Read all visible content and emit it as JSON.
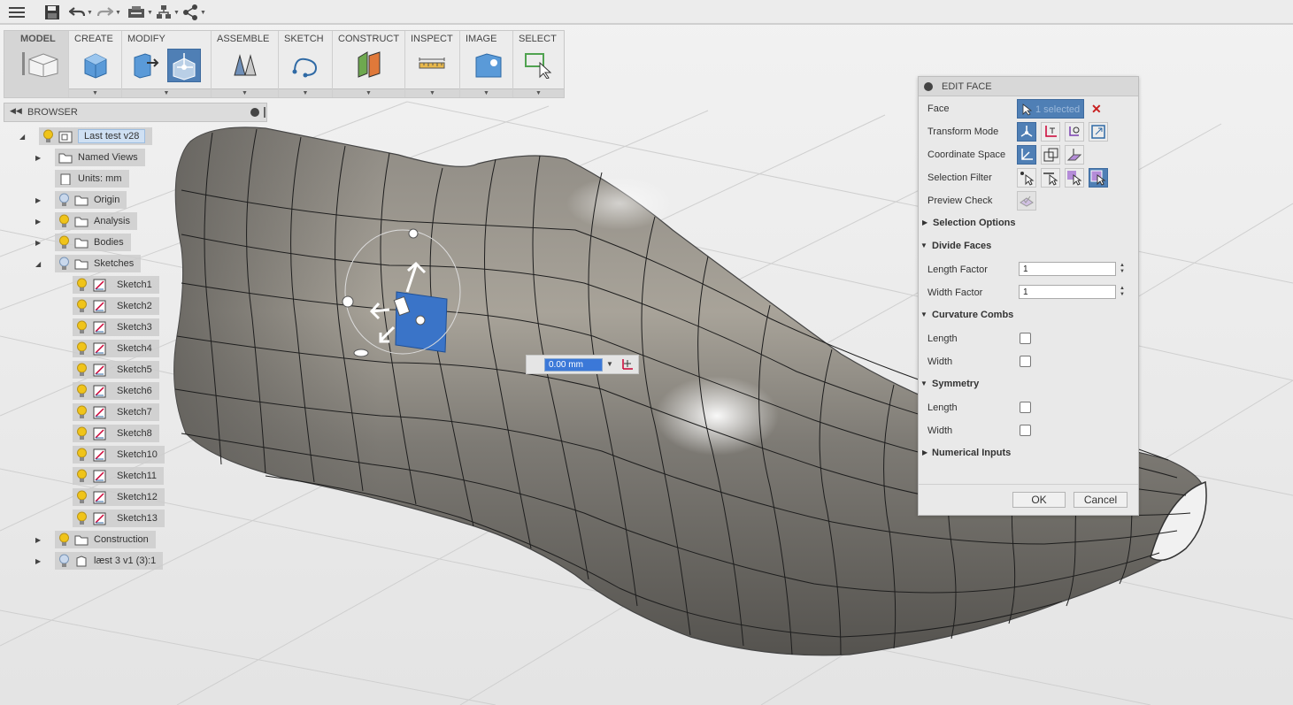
{
  "toolbar": {
    "icons": [
      "menu-icon",
      "save-icon",
      "undo-icon",
      "redo-icon",
      "job-status-icon",
      "data-panel-icon",
      "share-icon"
    ]
  },
  "ribbon": {
    "groups": [
      {
        "label": "MODEL",
        "icon": "model-workspace-icon"
      },
      {
        "label": "CREATE",
        "icon": "box-icon"
      },
      {
        "label": "MODIFY",
        "icon": "edit-form-icon"
      },
      {
        "label": "ASSEMBLE",
        "icon": "joint-icon"
      },
      {
        "label": "SKETCH",
        "icon": "spline-icon"
      },
      {
        "label": "CONSTRUCT",
        "icon": "plane-icon"
      },
      {
        "label": "INSPECT",
        "icon": "measure-icon"
      },
      {
        "label": "IMAGE",
        "icon": "render-icon"
      },
      {
        "label": "SELECT",
        "icon": "select-icon"
      }
    ]
  },
  "browser": {
    "title": "BROWSER",
    "root": "Last test v28",
    "items": [
      {
        "label": "Named Views"
      },
      {
        "label": "Units: mm"
      },
      {
        "label": "Origin"
      },
      {
        "label": "Analysis"
      },
      {
        "label": "Bodies"
      },
      {
        "label": "Sketches"
      }
    ],
    "sketches": [
      "Sketch1",
      "Sketch2",
      "Sketch3",
      "Sketch4",
      "Sketch5",
      "Sketch6",
      "Sketch7",
      "Sketch8",
      "Sketch10",
      "Sketch11",
      "Sketch12",
      "Sketch13"
    ],
    "tail": [
      {
        "label": "Construction"
      },
      {
        "label": "læst 3 v1 (3):1"
      }
    ]
  },
  "distance_input": {
    "value": "0.00 mm"
  },
  "edit_face": {
    "title": "EDIT FACE",
    "face_label": "Face",
    "face_value": "1 selected",
    "transform_mode_label": "Transform Mode",
    "coordinate_space_label": "Coordinate Space",
    "selection_filter_label": "Selection Filter",
    "preview_check_label": "Preview Check",
    "selection_options": "Selection Options",
    "divide_faces": "Divide Faces",
    "length_factor_label": "Length Factor",
    "length_factor_value": "1",
    "width_factor_label": "Width  Factor",
    "width_factor_value": "1",
    "curvature_combs": "Curvature Combs",
    "cc_length": "Length",
    "cc_width": "Width",
    "symmetry": "Symmetry",
    "sym_length": "Length",
    "sym_width": "Width",
    "numerical_inputs": "Numerical Inputs",
    "ok": "OK",
    "cancel": "Cancel"
  }
}
